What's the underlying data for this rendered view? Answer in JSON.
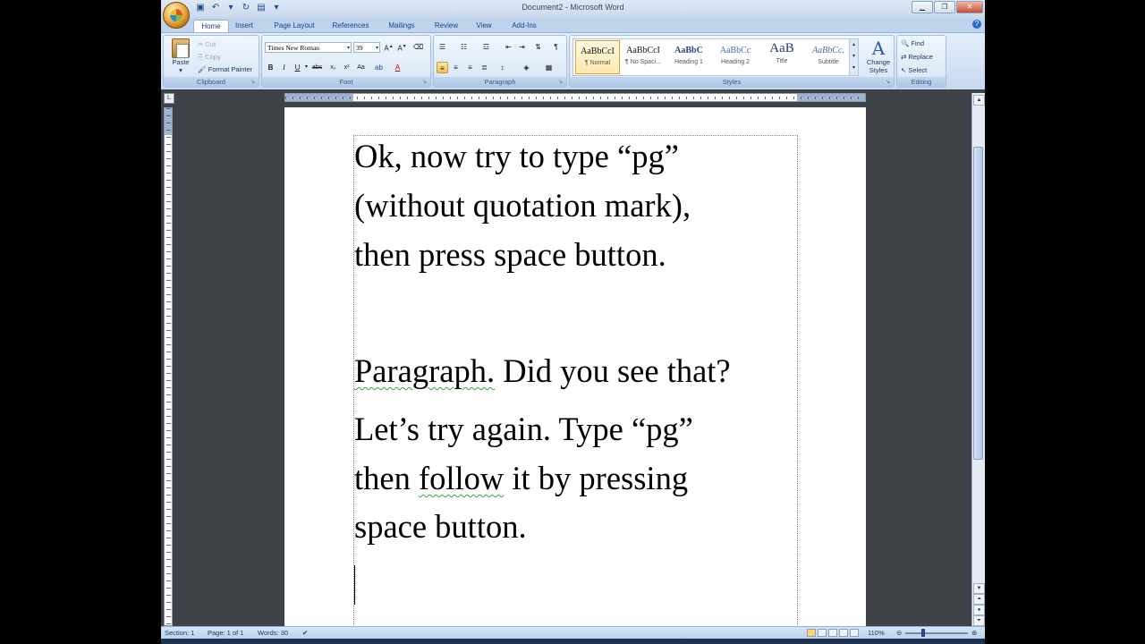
{
  "window": {
    "title": "Document2 - Microsoft Word"
  },
  "tabs": [
    "Home",
    "Insert",
    "Page Layout",
    "References",
    "Mailings",
    "Review",
    "View",
    "Add-Ins"
  ],
  "clipboard": {
    "paste": "Paste",
    "cut": "Cut",
    "copy": "Copy",
    "format_painter": "Format Painter",
    "label": "Clipboard"
  },
  "font": {
    "name": "Times New Roman",
    "size": "39",
    "label": "Font"
  },
  "paragraph": {
    "label": "Paragraph"
  },
  "styles": {
    "label": "Styles",
    "items": [
      {
        "sample": "AaBbCcI",
        "name": "¶ Normal"
      },
      {
        "sample": "AaBbCcI",
        "name": "¶ No Spaci..."
      },
      {
        "sample": "AaBbC",
        "name": "Heading 1"
      },
      {
        "sample": "AaBbCc",
        "name": "Heading 2"
      },
      {
        "sample": "AaB",
        "name": "Title"
      },
      {
        "sample": "AaBbCc.",
        "name": "Subtitle"
      }
    ],
    "change_styles": "Change Styles"
  },
  "editing": {
    "label": "Editing",
    "find": "Find",
    "replace": "Replace",
    "select": "Select"
  },
  "document": {
    "lines": [
      "Ok, now try to type “pg”",
      "(without quotation mark),",
      "then press space button.",
      "Did you see that?",
      "Let’s try again. Type “pg”",
      "then ",
      "follow",
      " it by pressing",
      "space button."
    ],
    "paragraph_word": "Paragraph.",
    "lets_word": "Let’s"
  },
  "status": {
    "section": "Section: 1",
    "page": "Page: 1 of 1",
    "words": "Words: 30",
    "zoom": "110%"
  },
  "colors": {
    "ribbon": "#c7d9f0",
    "workspace": "#3f4246",
    "accent": "#15428b"
  }
}
